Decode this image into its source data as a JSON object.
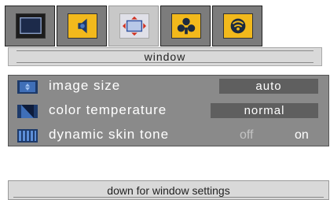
{
  "tabs": [
    {
      "icon": "monitor-icon",
      "selected": false
    },
    {
      "icon": "speaker-icon",
      "selected": false
    },
    {
      "icon": "window-resize-icon",
      "selected": true
    },
    {
      "icon": "settings-clubs-icon",
      "selected": false
    },
    {
      "icon": "antenna-icon",
      "selected": false
    }
  ],
  "title": "window",
  "menu": {
    "items": [
      {
        "label": "image size",
        "value": "auto",
        "icon": "image-size-icon"
      },
      {
        "label": "color temperature",
        "value": "normal",
        "icon": "color-temperature-icon"
      },
      {
        "label": "dynamic skin tone",
        "options": [
          "off",
          "on"
        ],
        "selected": "on",
        "icon": "skin-tone-icon"
      }
    ]
  },
  "hint": "down for window settings",
  "colors": {
    "accent": "#f2b91c",
    "menu_bg": "#8a8a8a",
    "value_bg": "#5f5f5f"
  }
}
